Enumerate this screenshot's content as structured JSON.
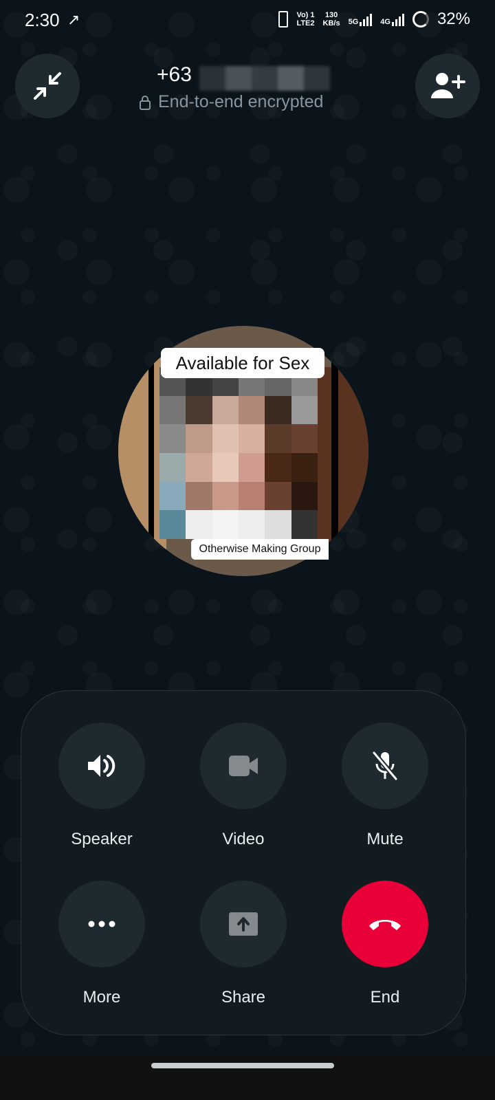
{
  "status_bar": {
    "time": "2:30",
    "net_line1": "Vo) 1",
    "net_line2": "LTE2",
    "speed_top": "130",
    "speed_bottom": "KB/s",
    "network1": "5G",
    "network2": "4G",
    "battery": "32%"
  },
  "call": {
    "contact_prefix": "+63",
    "encryption_text": "End-to-end encrypted",
    "avatar_caption_top": "Available for Sex",
    "avatar_caption_bottom": "Otherwise Making Group"
  },
  "controls": [
    {
      "label": "Speaker",
      "icon": "speaker-icon"
    },
    {
      "label": "Video",
      "icon": "video-icon"
    },
    {
      "label": "Mute",
      "icon": "mic-off-icon"
    },
    {
      "label": "More",
      "icon": "more-icon"
    },
    {
      "label": "Share",
      "icon": "share-screen-icon"
    },
    {
      "label": "End",
      "icon": "end-call-icon"
    }
  ],
  "colors": {
    "background": "#0b141a",
    "end_call": "#ea0038",
    "button_bg": "#1f2a30"
  }
}
